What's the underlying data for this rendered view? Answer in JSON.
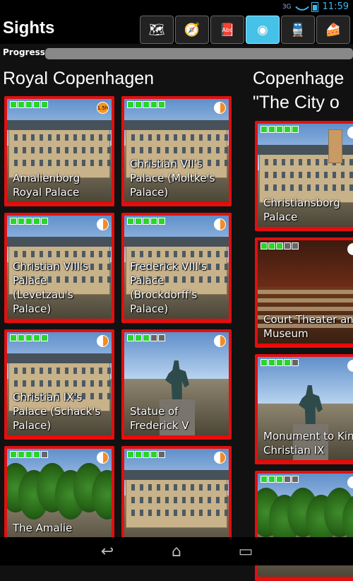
{
  "status": {
    "signal": "3G",
    "time": "11:59"
  },
  "app": {
    "title": "Sights"
  },
  "toolbar": [
    {
      "name": "map-icon",
      "glyph": "🗺"
    },
    {
      "name": "guide-icon",
      "glyph": "🧭"
    },
    {
      "name": "book-icon",
      "glyph": "📕",
      "label": "Abc"
    },
    {
      "name": "camera-icon",
      "glyph": "◉",
      "active": true
    },
    {
      "name": "train-icon",
      "glyph": "🚆"
    },
    {
      "name": "food-icon",
      "glyph": "🍰"
    }
  ],
  "progress": {
    "label": "Progress",
    "value": 0
  },
  "sections": [
    {
      "title": "Royal Copenhagen"
    },
    {
      "title": "Copenhage\n\"The City o"
    }
  ],
  "sights": [
    {
      "name": "Amalienborg\nRoyal Palace",
      "stars": 5,
      "badge": "1.5h"
    },
    {
      "name": "Christian VII's\nPalace (Moltke's\nPalace)",
      "stars": 5
    },
    {
      "name": "Christian VIII's\nPalace\n(Levetzau's\nPalace)",
      "stars": 5
    },
    {
      "name": "Frederick VIII's\nPalace\n(Brockdorff's\nPalace)",
      "stars": 5
    },
    {
      "name": "Christian IX's\nPalace (Schack's\nPalace)",
      "stars": 5
    },
    {
      "name": "Statue of\nFrederick V",
      "stars": 3
    },
    {
      "name": "The Amalie\nGarden",
      "stars": 4
    },
    {
      "name": "",
      "stars": 4
    },
    {
      "name": "Christiansborg\nPalace",
      "stars": 5
    },
    {
      "name": "Court Theater and\nMuseum",
      "stars": 3
    },
    {
      "name": "Monument to King\nChristian IX",
      "stars": 4
    },
    {
      "name": "",
      "stars": 3
    }
  ]
}
